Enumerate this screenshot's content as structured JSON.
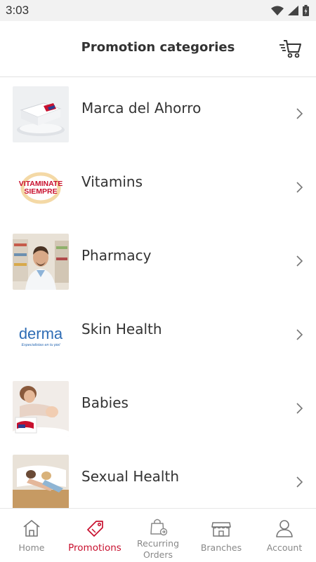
{
  "status_bar": {
    "time": "3:03"
  },
  "header": {
    "title": "Promotion categories"
  },
  "categories": [
    {
      "label": "Marca del Ahorro"
    },
    {
      "label": "Vitamins"
    },
    {
      "label": "Pharmacy"
    },
    {
      "label": "Skin Health"
    },
    {
      "label": "Babies"
    },
    {
      "label": "Sexual Health"
    }
  ],
  "thumbnail_logos": {
    "vitamins": "VITAMINATE\nSIEMPRE",
    "derma": "derma",
    "derma_tagline": "Especialistas en tu piel"
  },
  "tabs": [
    {
      "label": "Home",
      "icon": "home-icon"
    },
    {
      "label": "Promotions",
      "icon": "tag-icon",
      "active": true
    },
    {
      "label": "Recurring Orders",
      "icon": "recurring-bag-icon"
    },
    {
      "label": "Branches",
      "icon": "store-icon"
    },
    {
      "label": "Account",
      "icon": "person-icon"
    }
  ],
  "colors": {
    "accent": "#c8102e",
    "text": "#333333",
    "muted": "#888888"
  }
}
